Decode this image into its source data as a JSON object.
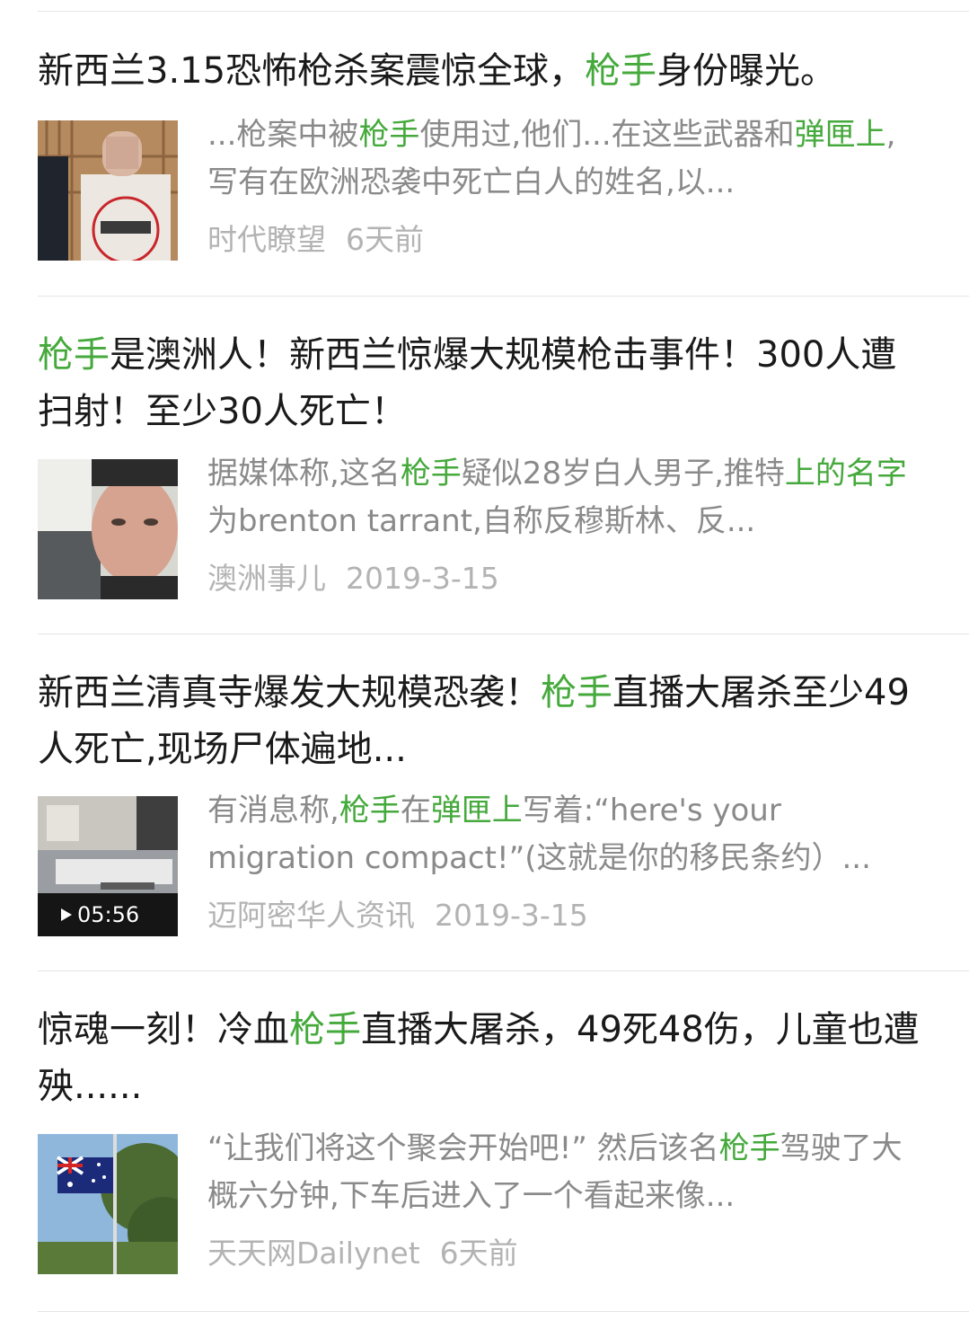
{
  "results": [
    {
      "title": [
        {
          "text": "新西兰3.15恐怖枪杀案震惊全球，",
          "hl": false
        },
        {
          "text": "枪手",
          "hl": true
        },
        {
          "text": "身份曝光。",
          "hl": false
        }
      ],
      "snippet": [
        {
          "text": "...枪案中被",
          "hl": false
        },
        {
          "text": "枪手",
          "hl": true
        },
        {
          "text": "使用过,他们...在这些武器和",
          "hl": false
        },
        {
          "text": "弹匣上",
          "hl": true
        },
        {
          "text": ",写有在欧洲恐袭中死亡白人的姓名,以...",
          "hl": false
        }
      ],
      "source": "时代瞭望",
      "time": "6天前",
      "thumb": "courtroom-photo"
    },
    {
      "title": [
        {
          "text": "枪手",
          "hl": true
        },
        {
          "text": "是澳洲人！新西兰惊爆大规模枪击事件！300人遭扫射！至少30人死亡！",
          "hl": false
        }
      ],
      "snippet": [
        {
          "text": "据媒体称,这名",
          "hl": false
        },
        {
          "text": "枪手",
          "hl": true
        },
        {
          "text": "疑似28岁白人男子,推特",
          "hl": false
        },
        {
          "text": "上的名字",
          "hl": true
        },
        {
          "text": "为brenton tarrant,自称反穆斯林、反...",
          "hl": false
        }
      ],
      "source": "澳洲事儿",
      "time": "2019-3-15",
      "thumb": "selfie-photo"
    },
    {
      "title": [
        {
          "text": "新西兰清真寺爆发大规模恐袭！",
          "hl": false
        },
        {
          "text": "枪手",
          "hl": true
        },
        {
          "text": "直播大屠杀至少49人死亡,现场尸体遍地...",
          "hl": false
        }
      ],
      "snippet": [
        {
          "text": "有消息称,",
          "hl": false
        },
        {
          "text": "枪手",
          "hl": true
        },
        {
          "text": "在",
          "hl": false
        },
        {
          "text": "弹匣上",
          "hl": true
        },
        {
          "text": "写着:“here's your migration compact!”(这就是你的移民条约）...",
          "hl": false
        }
      ],
      "source": "迈阿密华人资讯",
      "time": "2019-3-15",
      "thumb": "video-still",
      "duration": "05:56"
    },
    {
      "title": [
        {
          "text": "惊魂一刻！冷血",
          "hl": false
        },
        {
          "text": "枪手",
          "hl": true
        },
        {
          "text": "直播大屠杀，49死48伤，儿童也遭殃......",
          "hl": false
        }
      ],
      "snippet": [
        {
          "text": "“让我们将这个聚会开始吧!” 然后该名",
          "hl": false
        },
        {
          "text": "枪手",
          "hl": true
        },
        {
          "text": "驾驶了大概六分钟,下车后进入了一个看起来像...",
          "hl": false
        }
      ],
      "source": "天天网Dailynet",
      "time": "6天前",
      "thumb": "flag-photo"
    }
  ],
  "colors": {
    "highlight": "#45a93c",
    "text": "#1a1a1a",
    "snippet": "#8a8a8a",
    "meta": "#b3b3b3",
    "divider": "#e5e5e5"
  }
}
